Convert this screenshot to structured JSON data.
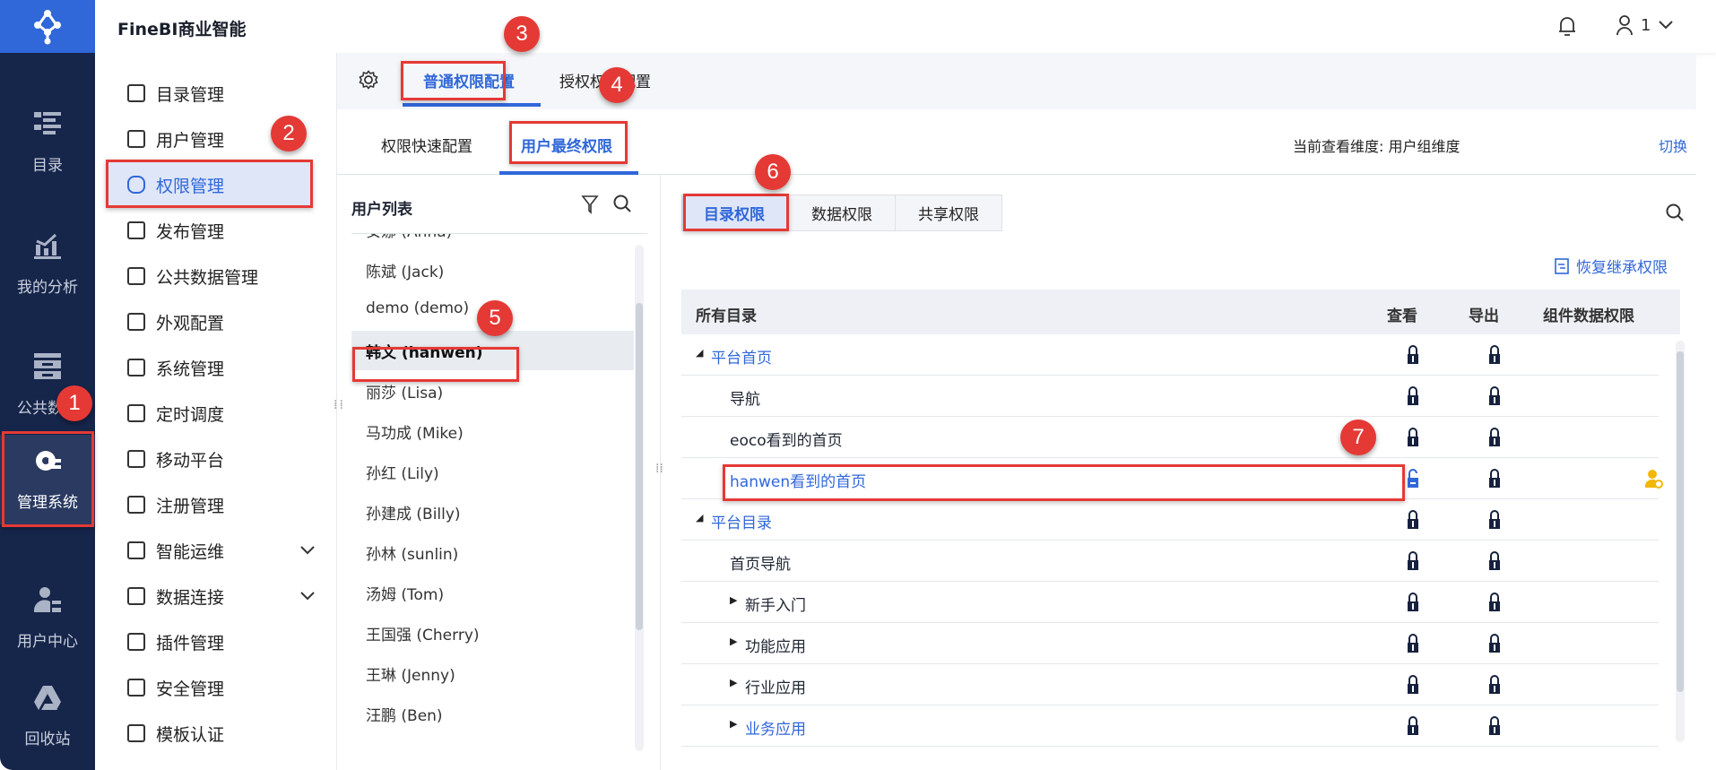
{
  "app": {
    "title": "FineBI商业智能",
    "user": "1"
  },
  "nav": [
    {
      "label": "目录",
      "icon": "catalog-icon"
    },
    {
      "label": "我的分析",
      "icon": "analysis-icon"
    },
    {
      "label": "公共数据",
      "icon": "public-data-icon"
    },
    {
      "label": "管理系统",
      "icon": "admin-gear-icon",
      "active": true
    },
    {
      "label": "用户中心",
      "icon": "user-center-icon"
    },
    {
      "label": "回收站",
      "icon": "recycle-icon"
    }
  ],
  "menu": [
    {
      "label": "目录管理",
      "icon": "list-icon"
    },
    {
      "label": "用户管理",
      "icon": "user-icon"
    },
    {
      "label": "权限管理",
      "icon": "shield-key-icon",
      "active": true
    },
    {
      "label": "发布管理",
      "icon": "publish-icon"
    },
    {
      "label": "公共数据管理",
      "icon": "data-icon"
    },
    {
      "label": "外观配置",
      "icon": "brush-icon"
    },
    {
      "label": "系统管理",
      "icon": "gear-icon"
    },
    {
      "label": "定时调度",
      "icon": "timer-icon"
    },
    {
      "label": "移动平台",
      "icon": "mobile-icon"
    },
    {
      "label": "注册管理",
      "icon": "register-icon"
    },
    {
      "label": "智能运维",
      "icon": "ops-icon",
      "expand": true
    },
    {
      "label": "数据连接",
      "icon": "paperclip-icon",
      "expand": true
    },
    {
      "label": "插件管理",
      "icon": "puzzle-icon"
    },
    {
      "label": "安全管理",
      "icon": "shield-plus-icon"
    },
    {
      "label": "模板认证",
      "icon": "certify-icon"
    }
  ],
  "tabs": {
    "normal": "普通权限配置",
    "grant": "授权权限配置"
  },
  "subtabs": {
    "quick": "权限快速配置",
    "final": "用户最终权限",
    "dimension_label": "当前查看维度: 用户组维度",
    "switch": "切换"
  },
  "userlist": {
    "title": "用户列表",
    "users": [
      "安娜 (Anna)",
      "陈斌 (Jack)",
      "demo (demo)",
      "韩文 (hanwen)",
      "丽莎 (Lisa)",
      "马功成 (Mike)",
      "孙红 (Lily)",
      "孙建成 (Billy)",
      "孙林 (sunlin)",
      "汤姆 (Tom)",
      "王国强 (Cherry)",
      "王琳 (Jenny)",
      "汪鹏 (Ben)"
    ],
    "selected": 3
  },
  "perm": {
    "tabs": [
      "目录权限",
      "数据权限",
      "共享权限"
    ],
    "restore": "恢复继承权限",
    "columns": [
      "所有目录",
      "查看",
      "导出",
      "组件数据权限"
    ],
    "rows": [
      {
        "name": "平台首页",
        "level": 0,
        "caret": "down",
        "link": true,
        "view": "locked",
        "export": "locked"
      },
      {
        "name": "导航",
        "level": 1,
        "view": "locked",
        "export": "locked"
      },
      {
        "name": "eoco看到的首页",
        "level": 1,
        "view": "locked",
        "export": "locked"
      },
      {
        "name": "hanwen看到的首页",
        "level": 1,
        "link": true,
        "view": "unlocked",
        "export": "locked",
        "component": true
      },
      {
        "name": "平台目录",
        "level": 0,
        "caret": "down",
        "link": true,
        "view": "locked",
        "export": "locked"
      },
      {
        "name": "首页导航",
        "level": 1,
        "view": "locked",
        "export": "locked"
      },
      {
        "name": "新手入门",
        "level": 1,
        "caret": "right",
        "view": "locked",
        "export": "locked"
      },
      {
        "name": "功能应用",
        "level": 1,
        "caret": "right",
        "view": "locked",
        "export": "locked"
      },
      {
        "name": "行业应用",
        "level": 1,
        "caret": "right",
        "view": "locked",
        "export": "locked"
      },
      {
        "name": "业务应用",
        "level": 1,
        "caret": "right",
        "link": true,
        "view": "locked",
        "export": "locked"
      }
    ]
  },
  "annotations": [
    "1",
    "2",
    "3",
    "4",
    "5",
    "6",
    "7"
  ],
  "colors": {
    "accent": "#3067d9",
    "nav": "#16254a",
    "annotation": "#e53935"
  }
}
